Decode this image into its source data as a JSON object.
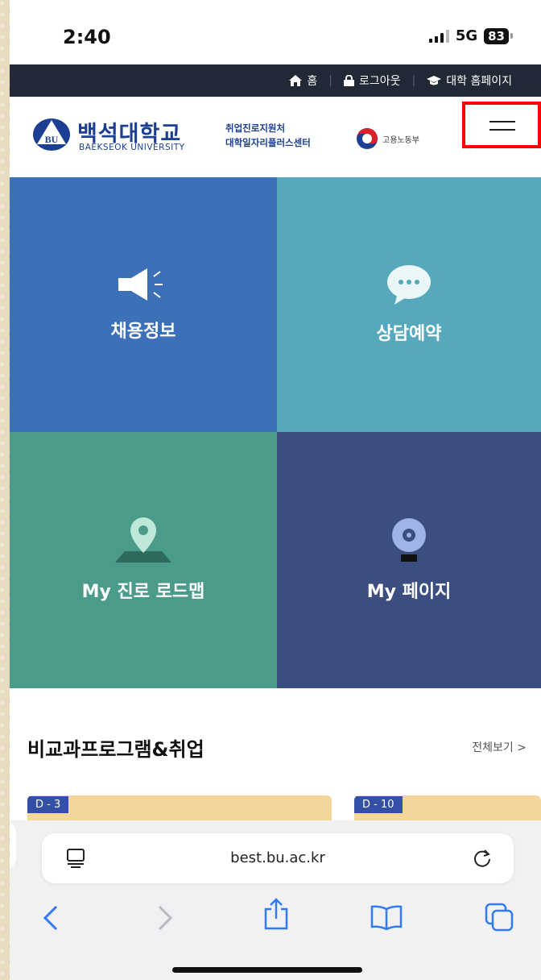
{
  "status": {
    "time": "2:40",
    "network": "5G",
    "battery": "83"
  },
  "util_nav": {
    "home": "홈",
    "logout": "로그아웃",
    "univ_home": "대학 홈페이지"
  },
  "header": {
    "logo_ko": "백석대학교",
    "logo_en": "BAEKSEOK UNIVERSITY",
    "logo_badge": "BU",
    "center_line1": "취업진로지원처",
    "center_line2": "대학일자리플러스센터",
    "ministry": "고용노동부"
  },
  "tiles": [
    {
      "label": "채용정보",
      "icon": "megaphone-icon",
      "color": "#3c70b8"
    },
    {
      "label": "상담예약",
      "icon": "chat-bubble-icon",
      "color": "#56a8bd"
    },
    {
      "label": "My 진로 로드맵",
      "icon": "map-pin-icon",
      "color": "#4b9b8a"
    },
    {
      "label": "My 페이지",
      "icon": "lightbulb-gear-icon",
      "color": "#3b4e7f"
    }
  ],
  "programs": {
    "title": "비교과프로그램&취업",
    "see_all": "전체보기 >",
    "cards": [
      {
        "dday": "D - 3"
      },
      {
        "dday": "D - 10"
      }
    ]
  },
  "browser": {
    "url": "best.bu.ac.kr"
  },
  "colors": {
    "nav": "#222836",
    "brand": "#1c3f94",
    "highlight": "#ff0000",
    "safari_blue": "#2f7bf5"
  }
}
